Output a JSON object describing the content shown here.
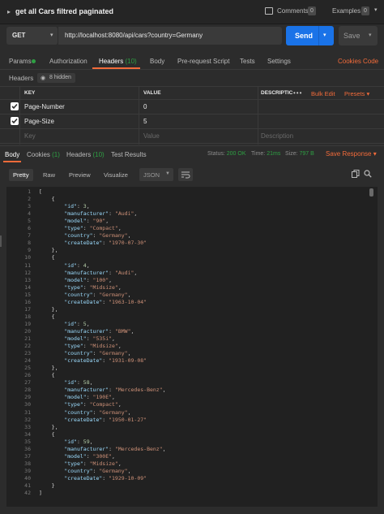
{
  "window": {
    "title": "get all Cars filtred paginated",
    "comments_label": "Comments",
    "comments_count": "0",
    "examples_label": "Examples",
    "examples_count": "0"
  },
  "request": {
    "method": "GET",
    "url": "http://localhost:8080/api/cars?country=Germany",
    "send_label": "Send",
    "save_label": "Save"
  },
  "request_tabs": {
    "params": "Params",
    "authorization": "Authorization",
    "headers": "Headers",
    "headers_count": "(10)",
    "body": "Body",
    "prerequest": "Pre-request Script",
    "tests": "Tests",
    "settings": "Settings",
    "cookies": "Cookies",
    "code": "Code"
  },
  "headers_section": {
    "label": "Headers",
    "hidden": "8 hidden"
  },
  "params_table": {
    "col_key": "KEY",
    "col_value": "VALUE",
    "col_description": "DESCRIPTIC",
    "more": "•••",
    "bulk_edit": "Bulk Edit",
    "presets": "Presets",
    "rows": [
      {
        "key": "Page-Number",
        "value": "0"
      },
      {
        "key": "Page-Size",
        "value": "5"
      }
    ],
    "placeholder_key": "Key",
    "placeholder_value": "Value",
    "placeholder_description": "Description"
  },
  "response_tabs": {
    "body": "Body",
    "cookies": "Cookies",
    "cookies_count": "(1)",
    "headers": "Headers",
    "headers_count": "(10)",
    "test_results": "Test Results"
  },
  "response_status": {
    "status_label": "Status:",
    "status_value": "200 OK",
    "time_label": "Time:",
    "time_value": "21ms",
    "size_label": "Size:",
    "size_value": "797 B",
    "save_response": "Save Response"
  },
  "response_toolbar": {
    "pretty": "Pretty",
    "raw": "Raw",
    "preview": "Preview",
    "visualize": "Visualize",
    "format": "JSON"
  },
  "code_lines": [
    "[",
    "    {",
    "        \"id\": 3,",
    "        \"manufacturer\": \"Audi\",",
    "        \"model\": \"90\",",
    "        \"type\": \"Compact\",",
    "        \"country\": \"Germany\",",
    "        \"createDate\": \"1970-07-30\"",
    "    },",
    "    {",
    "        \"id\": 4,",
    "        \"manufacturer\": \"Audi\",",
    "        \"model\": \"100\",",
    "        \"type\": \"Midsize\",",
    "        \"country\": \"Germany\",",
    "        \"createDate\": \"1963-10-04\"",
    "    },",
    "    {",
    "        \"id\": 5,",
    "        \"manufacturer\": \"BMW\",",
    "        \"model\": \"535i\",",
    "        \"type\": \"Midsize\",",
    "        \"country\": \"Germany\",",
    "        \"createDate\": \"1931-09-08\"",
    "    },",
    "    {",
    "        \"id\": 58,",
    "        \"manufacturer\": \"Mercedes-Benz\",",
    "        \"model\": \"190E\",",
    "        \"type\": \"Compact\",",
    "        \"country\": \"Germany\",",
    "        \"createDate\": \"1950-01-27\"",
    "    },",
    "    {",
    "        \"id\": 59,",
    "        \"manufacturer\": \"Mercedes-Benz\",",
    "        \"model\": \"300E\",",
    "        \"type\": \"Midsize\",",
    "        \"country\": \"Germany\",",
    "        \"createDate\": \"1929-10-09\"",
    "    }",
    "]"
  ],
  "colors": {
    "accent": "#f26b3a",
    "send": "#1a73e8",
    "success": "#2ea043"
  }
}
